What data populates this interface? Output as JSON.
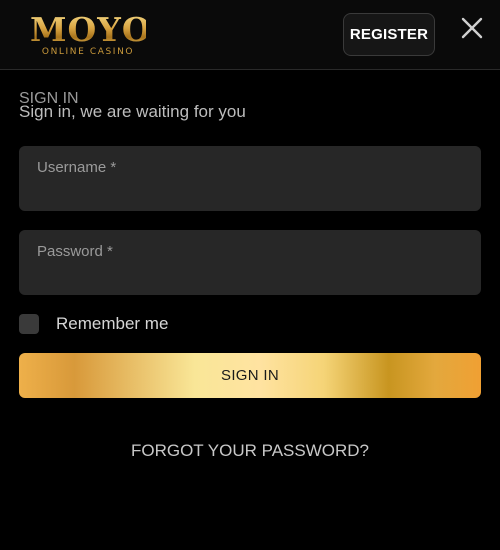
{
  "header": {
    "logo": {
      "word": "MOYO",
      "tagline": "ONLINE CASINO"
    },
    "register_label": "REGISTER",
    "close_icon": "close-icon"
  },
  "form": {
    "title": "SIGN IN",
    "subtitle": "Sign in, we are waiting for you",
    "username": {
      "label": "Username *",
      "value": ""
    },
    "password": {
      "label": "Password *",
      "value": ""
    },
    "remember_label": "Remember me",
    "remember_checked": false,
    "submit_label": "SIGN IN",
    "forgot_label": "FORGOT YOUR PASSWORD?"
  },
  "colors": {
    "background": "#000000",
    "field_bg": "#272727",
    "gold": "#d9a441",
    "button_gradient_start": "#eeb04a",
    "button_gradient_end": "#f0a033"
  }
}
